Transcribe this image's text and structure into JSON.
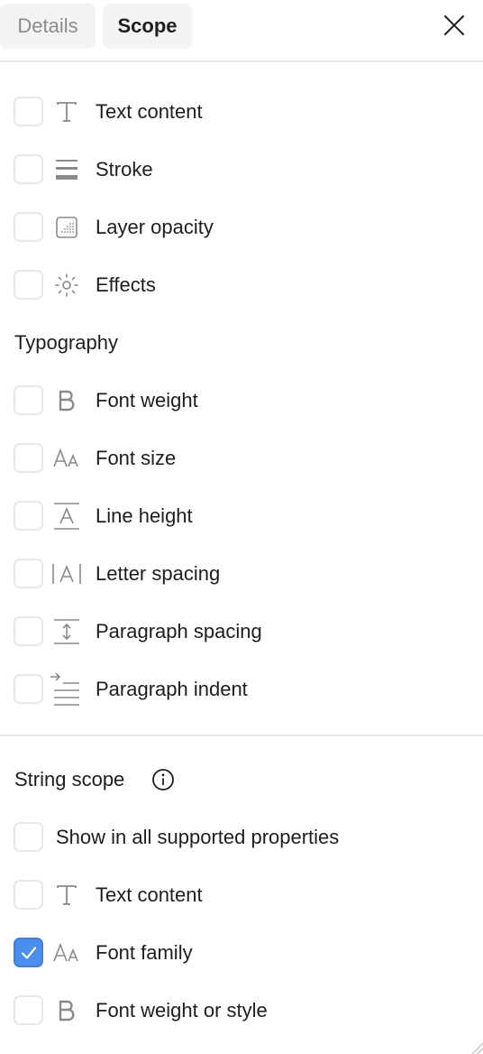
{
  "header": {
    "tab_details": "Details",
    "tab_scope": "Scope",
    "close_icon": "close-icon"
  },
  "layer_section": {
    "items": [
      {
        "label": "Text content",
        "icon": "text-icon",
        "checked": false
      },
      {
        "label": "Stroke",
        "icon": "stroke-icon",
        "checked": false
      },
      {
        "label": "Layer opacity",
        "icon": "opacity-icon",
        "checked": false
      },
      {
        "label": "Effects",
        "icon": "effects-icon",
        "checked": false
      }
    ]
  },
  "typography": {
    "title": "Typography",
    "items": [
      {
        "label": "Font weight",
        "icon": "font-weight-icon",
        "checked": false
      },
      {
        "label": "Font size",
        "icon": "font-size-icon",
        "checked": false
      },
      {
        "label": "Line height",
        "icon": "line-height-icon",
        "checked": false
      },
      {
        "label": "Letter spacing",
        "icon": "letter-spacing-icon",
        "checked": false
      },
      {
        "label": "Paragraph spacing",
        "icon": "paragraph-spacing-icon",
        "checked": false
      },
      {
        "label": "Paragraph indent",
        "icon": "paragraph-indent-icon",
        "checked": false
      }
    ]
  },
  "string_scope": {
    "title": "String scope",
    "info_icon": "info-icon",
    "show_all_label": "Show in all supported properties",
    "show_all_checked": false,
    "items": [
      {
        "label": "Text content",
        "icon": "text-icon",
        "checked": false
      },
      {
        "label": "Font family",
        "icon": "font-family-icon",
        "checked": true
      },
      {
        "label": "Font weight or style",
        "icon": "font-weight-icon",
        "checked": false
      }
    ]
  },
  "colors": {
    "accent": "#4a8ef0",
    "checkbox_border": "#e8e8e8",
    "divider": "#e6e6e6",
    "icon": "#8a8a8a",
    "text": "#1e1e1e",
    "muted_text": "#8c8c8c"
  }
}
